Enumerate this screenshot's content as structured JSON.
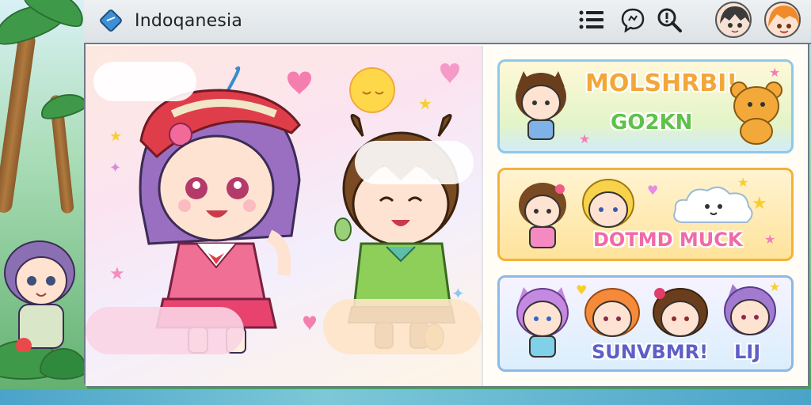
{
  "app": {
    "title": "Indoqanesia",
    "brand_icon": "diamond-gem-icon"
  },
  "toolbar": {
    "icons": [
      "menu-list-icon",
      "chat-bubble-icon",
      "search-icon"
    ]
  },
  "avatars": [
    {
      "name": "avatar-user-1",
      "hair": "#3b3b3b"
    },
    {
      "name": "avatar-user-2",
      "hair": "#f08a2b"
    }
  ],
  "cards": [
    {
      "title": "MOLSHRBI!",
      "subtitle": "GO2KN",
      "title_color": "#f2a73a",
      "subtitle_color": "#5fc14a"
    },
    {
      "title": "DOTMD MUCK",
      "subtitle": "",
      "title_color": "#f06aa8",
      "subtitle_color": ""
    },
    {
      "title": "SUNVBMR!",
      "subtitle": "LIJ",
      "title_color": "#5e5fc7",
      "subtitle_color": "#5e5fc7"
    }
  ]
}
